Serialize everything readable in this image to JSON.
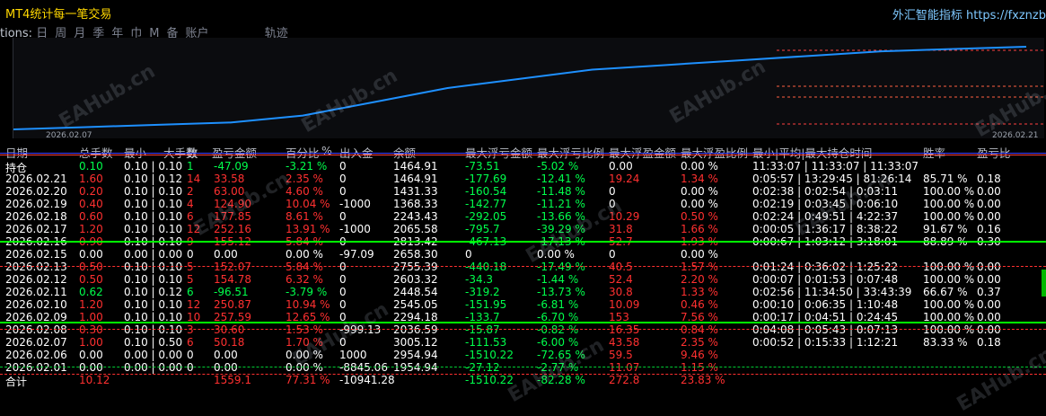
{
  "app": {
    "title": "MT4统计每一笔交易",
    "brand": "外汇智能指标  https://fxznzb"
  },
  "toolbar": {
    "truncated_label": "tions:",
    "periods": [
      "日",
      "周",
      "月",
      "季",
      "年",
      "巾",
      "M",
      "备",
      "账户"
    ],
    "path_label": "轨迹"
  },
  "chart": {
    "start_date": "2026.02.07",
    "end_date": "2026.02.21",
    "equity": [
      {
        "x": 0,
        "y": 0
      },
      {
        "x": 1,
        "y": 0.5
      },
      {
        "x": 2,
        "y": 1
      },
      {
        "x": 3,
        "y": 1.5
      },
      {
        "x": 4,
        "y": 3
      },
      {
        "x": 5,
        "y": 6
      },
      {
        "x": 6,
        "y": 9
      },
      {
        "x": 7,
        "y": 11
      },
      {
        "x": 8,
        "y": 13
      },
      {
        "x": 9,
        "y": 14
      },
      {
        "x": 10,
        "y": 15
      },
      {
        "x": 11,
        "y": 16
      },
      {
        "x": 12,
        "y": 17
      },
      {
        "x": 13,
        "y": 17.5
      },
      {
        "x": 14,
        "y": 18
      }
    ],
    "line_color": "#1e90ff"
  },
  "table": {
    "headers": [
      "日期",
      "总手数",
      "最小",
      "大手数",
      "数",
      "盈亏金额",
      "百分比",
      "%",
      "出入金",
      "余额",
      "最大浮亏金额",
      "最大浮亏比例",
      "最大浮盈金额",
      "最大浮盈比例",
      "最小|平均|最大持仓时间",
      "胜率",
      "盈亏比"
    ],
    "rows": [
      [
        "持仓",
        "0.10",
        "0.10 | 0.10",
        "1",
        "-47.09",
        "-3.21 %",
        "0",
        "1464.91",
        "-73.51",
        "-5.02 %",
        "0.00",
        "0.00 %",
        "11:33:07 | 11:33:07 | 11:33:07",
        "",
        ""
      ],
      [
        "2026.02.21",
        "1.60",
        "0.10 | 0.12",
        "14",
        "33.58",
        "2.35 %",
        "0",
        "1464.91",
        "-177.69",
        "-12.41 %",
        "19.24",
        "1.34 %",
        "0:05:57 | 13:29:45 | 81:26:14",
        "85.71 %",
        "0.18"
      ],
      [
        "2026.02.20",
        "0.20",
        "0.10 | 0.10",
        "2",
        "63.00",
        "4.60 %",
        "0",
        "1431.33",
        "-160.54",
        "-11.48 %",
        "0",
        "0.00 %",
        "0:02:38 | 0:02:54 | 0:03:11",
        "100.00 %",
        "0.00"
      ],
      [
        "2026.02.19",
        "0.40",
        "0.10 | 0.10",
        "4",
        "124.90",
        "10.04 %",
        "-1000",
        "1368.33",
        "-142.77",
        "-11.21 %",
        "0",
        "0.00 %",
        "0:02:19 | 0:03:45 | 0:06:10",
        "100.00 %",
        "0.00"
      ],
      [
        "2026.02.18",
        "0.60",
        "0.10 | 0.10",
        "6",
        "177.85",
        "8.61 %",
        "0",
        "2243.43",
        "-292.05",
        "-13.66 %",
        "10.29",
        "0.50 %",
        "0:02:24 | 0:49:51 | 4:22:37",
        "100.00 %",
        "0.00"
      ],
      [
        "2026.02.17",
        "1.20",
        "0.10 | 0.10",
        "12",
        "252.16",
        "13.91 %",
        "-1000",
        "2065.58",
        "-795.7",
        "-39.29 %",
        "31.8",
        "1.66 %",
        "0:00:05 | 1:36:17 | 8:38:22",
        "91.67 %",
        "0.16"
      ],
      [
        "2026.02.16",
        "0.90",
        "0.10 | 0.10",
        "9",
        "155.12",
        "5.84 %",
        "0",
        "2813.42",
        "-467.13",
        "-17.13 %",
        "52.7",
        "1.93 %",
        "0:00:67 | 1:03:12 | 3:18:01",
        "88.89 %",
        "0.30"
      ],
      [
        "2026.02.15",
        "0.00",
        "0.00 | 0.00",
        "0",
        "0.00",
        "0.00 %",
        "-97.09",
        "2658.30",
        "0",
        "0.00 %",
        "0",
        "0.00 %",
        "",
        "",
        ""
      ],
      [
        "2026.02.13",
        "0.50",
        "0.10 | 0.10",
        "5",
        "152.07",
        "5.84 %",
        "0",
        "2755.39",
        "-440.18",
        "-17.49 %",
        "40.5",
        "1.57 %",
        "0:01:24 | 0:36:02 | 1:25:22",
        "100.00 %",
        "0.00"
      ],
      [
        "2026.02.12",
        "0.50",
        "0.10 | 0.10",
        "5",
        "154.78",
        "6.32 %",
        "0",
        "2603.32",
        "-34.3",
        "-1.44 %",
        "52.4",
        "2.20 %",
        "0:00:07 | 0:01:53 | 0:07:48",
        "100.00 %",
        "0.00"
      ],
      [
        "2026.02.11",
        "0.62",
        "0.10 | 0.12",
        "6",
        "-96.51",
        "-3.79 %",
        "0",
        "2448.54",
        "-319.2",
        "-13.73 %",
        "30.8",
        "1.33 %",
        "0:02:56 | 11:34:50 | 33:43:39",
        "66.67 %",
        "0.37"
      ],
      [
        "2026.02.10",
        "1.20",
        "0.10 | 0.10",
        "12",
        "250.87",
        "10.94 %",
        "0",
        "2545.05",
        "-151.95",
        "-6.81 %",
        "10.09",
        "0.46 %",
        "0:00:10 | 0:06:35 | 1:10:48",
        "100.00 %",
        "0.00"
      ],
      [
        "2026.02.09",
        "1.00",
        "0.10 | 0.10",
        "10",
        "257.59",
        "12.65 %",
        "0",
        "2294.18",
        "-133.7",
        "-6.70 %",
        "153",
        "7.56 %",
        "0:00:17 | 0:04:51 | 0:24:45",
        "100.00 %",
        "0.00"
      ],
      [
        "2026.02.08",
        "0.30",
        "0.10 | 0.10",
        "3",
        "30.60",
        "1.53 %",
        "-999.13",
        "2036.59",
        "-15.87",
        "-0.82 %",
        "16.35",
        "0.84 %",
        "0:04:08 | 0:05:43 | 0:07:13",
        "100.00 %",
        "0.00"
      ],
      [
        "2026.02.07",
        "1.00",
        "0.10 | 0.50",
        "6",
        "50.18",
        "1.70 %",
        "0",
        "3005.12",
        "-111.53",
        "-6.00 %",
        "43.58",
        "2.35 %",
        "0:00:52 | 0:15:33 | 1:12:21",
        "83.33 %",
        "0.18"
      ],
      [
        "2026.02.06",
        "0.00",
        "0.00 | 0.00",
        "0",
        "0.00",
        "0.00 %",
        "1000",
        "2954.94",
        "-1510.22",
        "-72.65 %",
        "59.5",
        "9.46 %",
        "",
        "",
        ""
      ],
      [
        "2026.02.01",
        "0.00",
        "0.00 | 0.00",
        "0",
        "0.00",
        "0.00 %",
        "-8845.06",
        "1954.94",
        "-27.12",
        "-2.77 %",
        "11.07",
        "1.15 %",
        "",
        "",
        ""
      ],
      [
        "合计",
        "10.12",
        "",
        "",
        "1559.1",
        "77.31 %",
        "-10941.28",
        "",
        "-1510.22",
        "-82.28 %",
        "272.8",
        "23.83 %",
        "",
        "",
        ""
      ]
    ],
    "row_colors": [
      "g",
      "r",
      "r",
      "r",
      "r",
      "r",
      "r",
      "w",
      "r",
      "r",
      "g",
      "r",
      "r",
      "r",
      "r",
      "w",
      "w",
      "r"
    ]
  },
  "watermark_text": "EAHub.cn"
}
